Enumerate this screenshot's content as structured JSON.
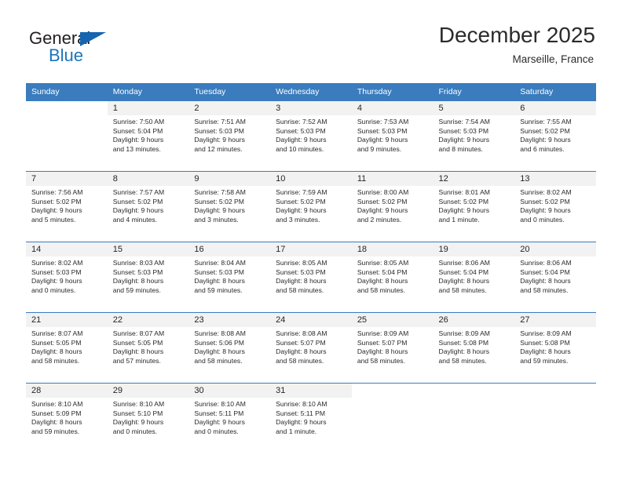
{
  "brand": {
    "name_top": "General",
    "name_bottom": "Blue",
    "triangle_icon": "triangle-icon",
    "accent_color": "#1b75bc"
  },
  "header": {
    "month_title": "December 2025",
    "location": "Marseille, France"
  },
  "theme": {
    "header_bg": "#3a7cbe",
    "daynum_bg": "#f2f2f2",
    "text": "#2a2a2a"
  },
  "calendar": {
    "weekday_headers": [
      "Sunday",
      "Monday",
      "Tuesday",
      "Wednesday",
      "Thursday",
      "Friday",
      "Saturday"
    ],
    "weeks": [
      [
        {
          "day": "",
          "lines": []
        },
        {
          "day": "1",
          "lines": [
            "Sunrise: 7:50 AM",
            "Sunset: 5:04 PM",
            "Daylight: 9 hours",
            "and 13 minutes."
          ]
        },
        {
          "day": "2",
          "lines": [
            "Sunrise: 7:51 AM",
            "Sunset: 5:03 PM",
            "Daylight: 9 hours",
            "and 12 minutes."
          ]
        },
        {
          "day": "3",
          "lines": [
            "Sunrise: 7:52 AM",
            "Sunset: 5:03 PM",
            "Daylight: 9 hours",
            "and 10 minutes."
          ]
        },
        {
          "day": "4",
          "lines": [
            "Sunrise: 7:53 AM",
            "Sunset: 5:03 PM",
            "Daylight: 9 hours",
            "and 9 minutes."
          ]
        },
        {
          "day": "5",
          "lines": [
            "Sunrise: 7:54 AM",
            "Sunset: 5:03 PM",
            "Daylight: 9 hours",
            "and 8 minutes."
          ]
        },
        {
          "day": "6",
          "lines": [
            "Sunrise: 7:55 AM",
            "Sunset: 5:02 PM",
            "Daylight: 9 hours",
            "and 6 minutes."
          ]
        }
      ],
      [
        {
          "day": "7",
          "lines": [
            "Sunrise: 7:56 AM",
            "Sunset: 5:02 PM",
            "Daylight: 9 hours",
            "and 5 minutes."
          ]
        },
        {
          "day": "8",
          "lines": [
            "Sunrise: 7:57 AM",
            "Sunset: 5:02 PM",
            "Daylight: 9 hours",
            "and 4 minutes."
          ]
        },
        {
          "day": "9",
          "lines": [
            "Sunrise: 7:58 AM",
            "Sunset: 5:02 PM",
            "Daylight: 9 hours",
            "and 3 minutes."
          ]
        },
        {
          "day": "10",
          "lines": [
            "Sunrise: 7:59 AM",
            "Sunset: 5:02 PM",
            "Daylight: 9 hours",
            "and 3 minutes."
          ]
        },
        {
          "day": "11",
          "lines": [
            "Sunrise: 8:00 AM",
            "Sunset: 5:02 PM",
            "Daylight: 9 hours",
            "and 2 minutes."
          ]
        },
        {
          "day": "12",
          "lines": [
            "Sunrise: 8:01 AM",
            "Sunset: 5:02 PM",
            "Daylight: 9 hours",
            "and 1 minute."
          ]
        },
        {
          "day": "13",
          "lines": [
            "Sunrise: 8:02 AM",
            "Sunset: 5:02 PM",
            "Daylight: 9 hours",
            "and 0 minutes."
          ]
        }
      ],
      [
        {
          "day": "14",
          "lines": [
            "Sunrise: 8:02 AM",
            "Sunset: 5:03 PM",
            "Daylight: 9 hours",
            "and 0 minutes."
          ]
        },
        {
          "day": "15",
          "lines": [
            "Sunrise: 8:03 AM",
            "Sunset: 5:03 PM",
            "Daylight: 8 hours",
            "and 59 minutes."
          ]
        },
        {
          "day": "16",
          "lines": [
            "Sunrise: 8:04 AM",
            "Sunset: 5:03 PM",
            "Daylight: 8 hours",
            "and 59 minutes."
          ]
        },
        {
          "day": "17",
          "lines": [
            "Sunrise: 8:05 AM",
            "Sunset: 5:03 PM",
            "Daylight: 8 hours",
            "and 58 minutes."
          ]
        },
        {
          "day": "18",
          "lines": [
            "Sunrise: 8:05 AM",
            "Sunset: 5:04 PM",
            "Daylight: 8 hours",
            "and 58 minutes."
          ]
        },
        {
          "day": "19",
          "lines": [
            "Sunrise: 8:06 AM",
            "Sunset: 5:04 PM",
            "Daylight: 8 hours",
            "and 58 minutes."
          ]
        },
        {
          "day": "20",
          "lines": [
            "Sunrise: 8:06 AM",
            "Sunset: 5:04 PM",
            "Daylight: 8 hours",
            "and 58 minutes."
          ]
        }
      ],
      [
        {
          "day": "21",
          "lines": [
            "Sunrise: 8:07 AM",
            "Sunset: 5:05 PM",
            "Daylight: 8 hours",
            "and 58 minutes."
          ]
        },
        {
          "day": "22",
          "lines": [
            "Sunrise: 8:07 AM",
            "Sunset: 5:05 PM",
            "Daylight: 8 hours",
            "and 57 minutes."
          ]
        },
        {
          "day": "23",
          "lines": [
            "Sunrise: 8:08 AM",
            "Sunset: 5:06 PM",
            "Daylight: 8 hours",
            "and 58 minutes."
          ]
        },
        {
          "day": "24",
          "lines": [
            "Sunrise: 8:08 AM",
            "Sunset: 5:07 PM",
            "Daylight: 8 hours",
            "and 58 minutes."
          ]
        },
        {
          "day": "25",
          "lines": [
            "Sunrise: 8:09 AM",
            "Sunset: 5:07 PM",
            "Daylight: 8 hours",
            "and 58 minutes."
          ]
        },
        {
          "day": "26",
          "lines": [
            "Sunrise: 8:09 AM",
            "Sunset: 5:08 PM",
            "Daylight: 8 hours",
            "and 58 minutes."
          ]
        },
        {
          "day": "27",
          "lines": [
            "Sunrise: 8:09 AM",
            "Sunset: 5:08 PM",
            "Daylight: 8 hours",
            "and 59 minutes."
          ]
        }
      ],
      [
        {
          "day": "28",
          "lines": [
            "Sunrise: 8:10 AM",
            "Sunset: 5:09 PM",
            "Daylight: 8 hours",
            "and 59 minutes."
          ]
        },
        {
          "day": "29",
          "lines": [
            "Sunrise: 8:10 AM",
            "Sunset: 5:10 PM",
            "Daylight: 9 hours",
            "and 0 minutes."
          ]
        },
        {
          "day": "30",
          "lines": [
            "Sunrise: 8:10 AM",
            "Sunset: 5:11 PM",
            "Daylight: 9 hours",
            "and 0 minutes."
          ]
        },
        {
          "day": "31",
          "lines": [
            "Sunrise: 8:10 AM",
            "Sunset: 5:11 PM",
            "Daylight: 9 hours",
            "and 1 minute."
          ]
        },
        {
          "day": "",
          "lines": []
        },
        {
          "day": "",
          "lines": []
        },
        {
          "day": "",
          "lines": []
        }
      ]
    ]
  }
}
